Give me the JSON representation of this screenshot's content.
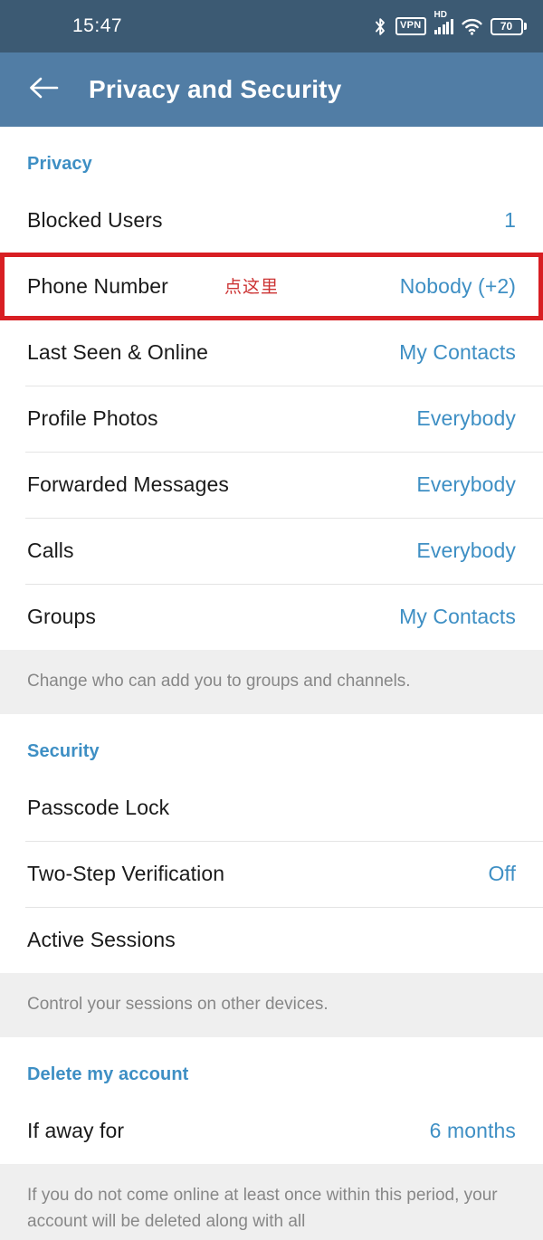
{
  "status_bar": {
    "time": "15:47",
    "icons": [
      {
        "name": "bluetooth-icon",
        "label": "Bluetooth"
      },
      {
        "name": "vpn-icon",
        "label": "VPN"
      },
      {
        "name": "hd-icon",
        "label": "HD"
      },
      {
        "name": "signal-bars-icon",
        "label": "Signal"
      },
      {
        "name": "wifi-icon",
        "label": "Wi-Fi"
      },
      {
        "name": "battery-icon",
        "label": "70"
      }
    ],
    "battery_level": "70",
    "vpn_label": "VPN",
    "hd_label": "HD",
    "background": "#3c5a73"
  },
  "app_bar": {
    "title": "Privacy and Security",
    "back_icon": "back-arrow-icon",
    "background": "#517da5"
  },
  "annotation": {
    "text": "点这里",
    "color": "#cc3333",
    "box_color": "#d81f23",
    "target_row": "Phone Number"
  },
  "colors": {
    "accent_blue": "#3e8fc4",
    "label_black": "#1a1a1a",
    "footer_gray_bg": "#efefef",
    "footer_gray_text": "#878787",
    "divider": "#e4e4e4"
  },
  "sections": [
    {
      "key": "privacy",
      "header": "Privacy",
      "rows": [
        {
          "label": "Blocked Users",
          "value": "1"
        },
        {
          "label": "Phone Number",
          "value": "Nobody (+2)"
        },
        {
          "label": "Last Seen & Online",
          "value": "My Contacts"
        },
        {
          "label": "Profile Photos",
          "value": "Everybody"
        },
        {
          "label": "Forwarded Messages",
          "value": "Everybody"
        },
        {
          "label": "Calls",
          "value": "Everybody"
        },
        {
          "label": "Groups",
          "value": "My Contacts"
        }
      ],
      "footer": "Change who can add you to groups and channels."
    },
    {
      "key": "security",
      "header": "Security",
      "rows": [
        {
          "label": "Passcode Lock",
          "value": ""
        },
        {
          "label": "Two-Step Verification",
          "value": "Off"
        },
        {
          "label": "Active Sessions",
          "value": ""
        }
      ],
      "footer": "Control your sessions on other devices."
    },
    {
      "key": "delete_account",
      "header": "Delete my account",
      "rows": [
        {
          "label": "If away for",
          "value": "6 months"
        }
      ],
      "footer": "If you do not come online at least once within this period, your account will be deleted along with all"
    }
  ]
}
